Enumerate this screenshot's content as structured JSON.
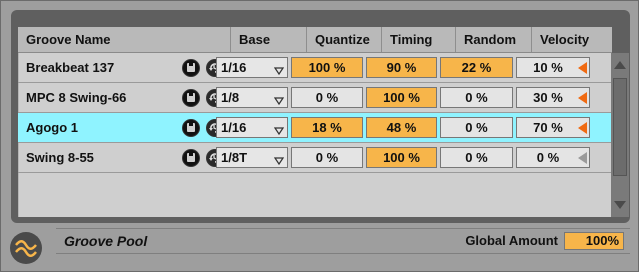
{
  "columns": {
    "name": "Groove Name",
    "base": "Base",
    "quantize": "Quantize",
    "timing": "Timing",
    "random": "Random",
    "velocity": "Velocity"
  },
  "rows": [
    {
      "name": "Breakbeat 137",
      "base": "1/16",
      "quantize": "100 %",
      "timing": "90 %",
      "random": "22 %",
      "velocity": "10 %",
      "selected": false
    },
    {
      "name": "MPC 8 Swing-66",
      "base": "1/8",
      "quantize": "0 %",
      "timing": "100 %",
      "random": "0 %",
      "velocity": "30 %",
      "selected": false
    },
    {
      "name": "Agogo 1",
      "base": "1/16",
      "quantize": "18 %",
      "timing": "48 %",
      "random": "0 %",
      "velocity": "70 %",
      "selected": true
    },
    {
      "name": "Swing 8-55",
      "base": "1/8T",
      "quantize": "0 %",
      "timing": "100 %",
      "random": "0 %",
      "velocity": "0 %",
      "selected": false
    }
  ],
  "footer": {
    "title": "Groove Pool",
    "global_amount_label": "Global Amount",
    "global_amount_value": "100%"
  },
  "icons": {
    "save": "hot-swap-save-icon",
    "commit": "commit-icon",
    "dropdown": "dropdown-triangle-icon",
    "velocity_marker": "velocity-triangle-icon",
    "pool": "groove-pool-icon"
  },
  "colors": {
    "accent_orange": "#f7b54a",
    "selected_row": "#8ff3ff",
    "velocity_triangle": "#f06a12"
  }
}
